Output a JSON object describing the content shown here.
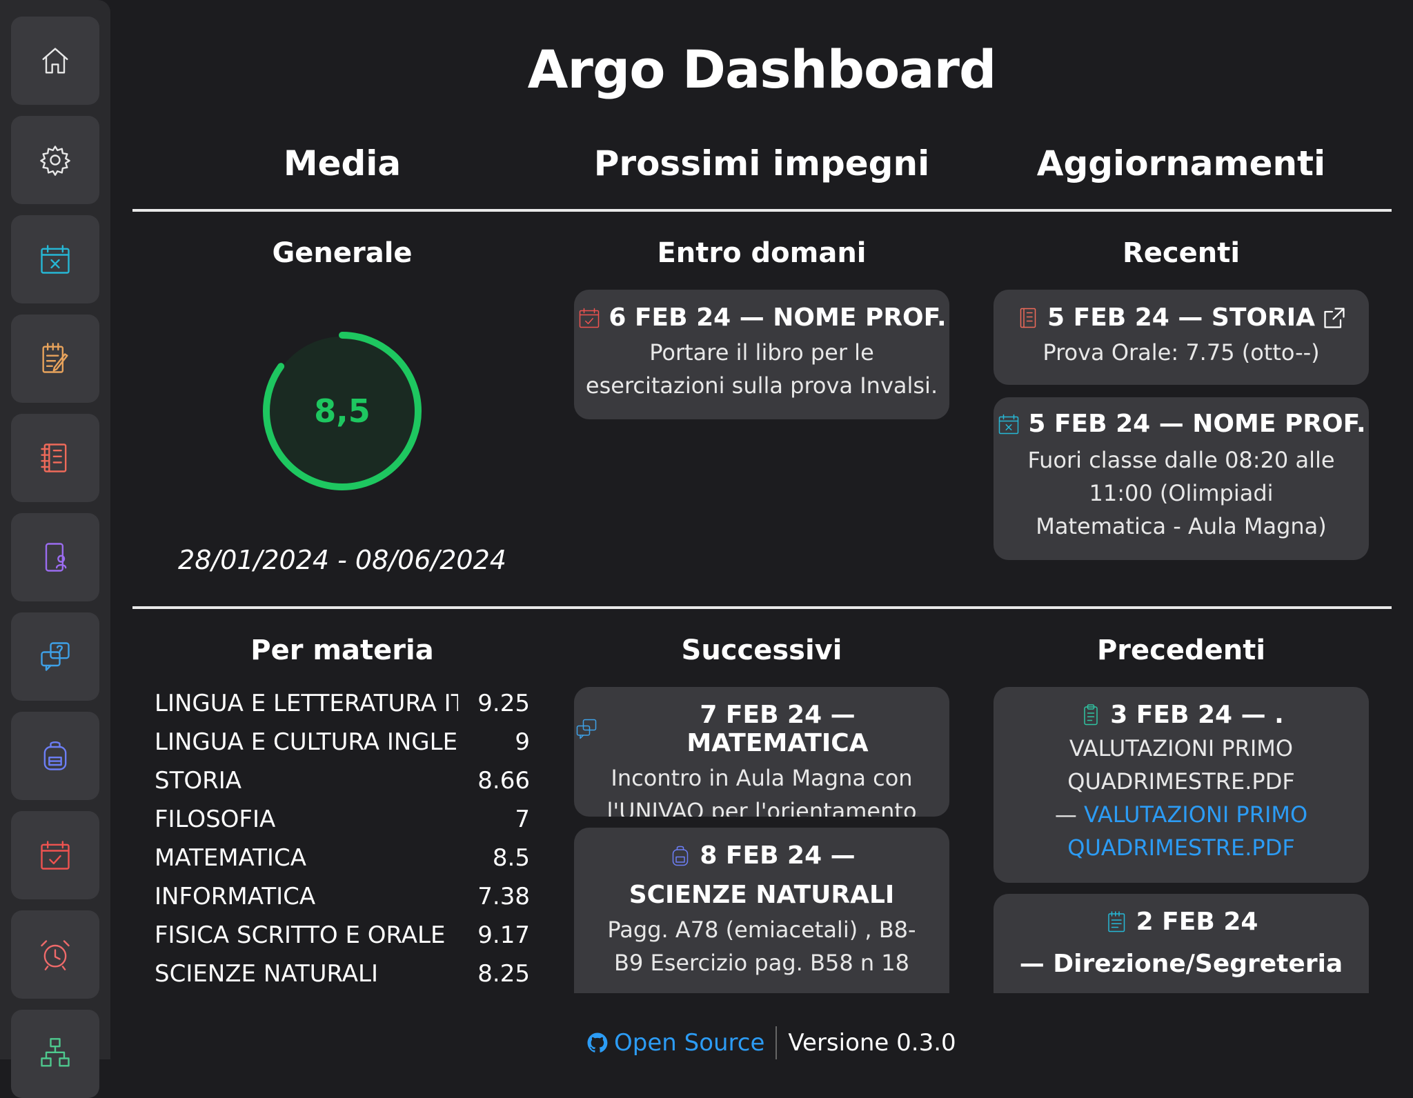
{
  "app": {
    "title": "Argo Dashboard"
  },
  "columns": {
    "media": "Media",
    "impegni": "Prossimi impegni",
    "aggiornamenti": "Aggiornamenti"
  },
  "media": {
    "generale_label": "Generale",
    "average": "8,5",
    "average_value": 8.5,
    "date_range": "28/01/2024 - 08/06/2024",
    "per_materia_label": "Per materia",
    "subjects": [
      {
        "name": "LINGUA E LETTERATURA ITALIANA",
        "value": "9.25"
      },
      {
        "name": "LINGUA E CULTURA INGLESE",
        "value": "9"
      },
      {
        "name": "STORIA",
        "value": "8.66"
      },
      {
        "name": "FILOSOFIA",
        "value": "7"
      },
      {
        "name": "MATEMATICA",
        "value": "8.5"
      },
      {
        "name": "INFORMATICA",
        "value": "7.38"
      },
      {
        "name": "FISICA SCRITTO E ORALE",
        "value": "9.17"
      },
      {
        "name": "SCIENZE NATURALI",
        "value": "8.25"
      }
    ]
  },
  "impegni": {
    "entro_domani_label": "Entro domani",
    "successivi_label": "Successivi",
    "entro_domani": [
      {
        "icon": "calendar-check-icon",
        "header": "6 FEB 24 — NOME PROF.",
        "body": "Portare il libro per le esercitazioni sulla prova Invalsi."
      }
    ],
    "successivi": [
      {
        "icon": "chat-question-icon",
        "header": "7 FEB 24 — MATEMATICA",
        "body": "Incontro in Aula Magna con l'UNIVAQ per l'orientamento"
      },
      {
        "icon": "backpack-icon",
        "header": "8 FEB 24 —",
        "header2": "SCIENZE NATURALI",
        "body": "Pagg. A78 (emiacetali) , B8-B9 Esercizio pag. B58 n 18"
      }
    ]
  },
  "aggiornamenti": {
    "recenti_label": "Recenti",
    "precedenti_label": "Precedenti",
    "recenti": [
      {
        "icon": "grade-book-icon",
        "header": "5 FEB 24 — STORIA",
        "body": "Prova Orale: 7.75 (otto--)"
      },
      {
        "icon": "calendar-x-icon",
        "header": "5 FEB 24 — NOME PROF.",
        "body": "Fuori classe dalle 08:20 alle 11:00 (Olimpiadi Matematica - Aula Magna)"
      }
    ],
    "precedenti": [
      {
        "icon": "clipboard-icon",
        "header": "3 FEB 24 — .",
        "body": "VALUTAZIONI PRIMO QUADRIMESTRE.PDF",
        "body2": "—",
        "link": "VALUTAZIONI PRIMO QUADRIMESTRE.PDF"
      },
      {
        "icon": "notepad-icon",
        "header": "2 FEB 24",
        "header2": "— Direzione/Segreteria"
      }
    ]
  },
  "footer": {
    "open_source": "Open Source",
    "version": "Versione 0.3.0"
  },
  "colors": {
    "background": "#1c1c1f",
    "card": "#3a3a3e",
    "accent_green": "#1ec760",
    "link": "#2c9cf5"
  }
}
